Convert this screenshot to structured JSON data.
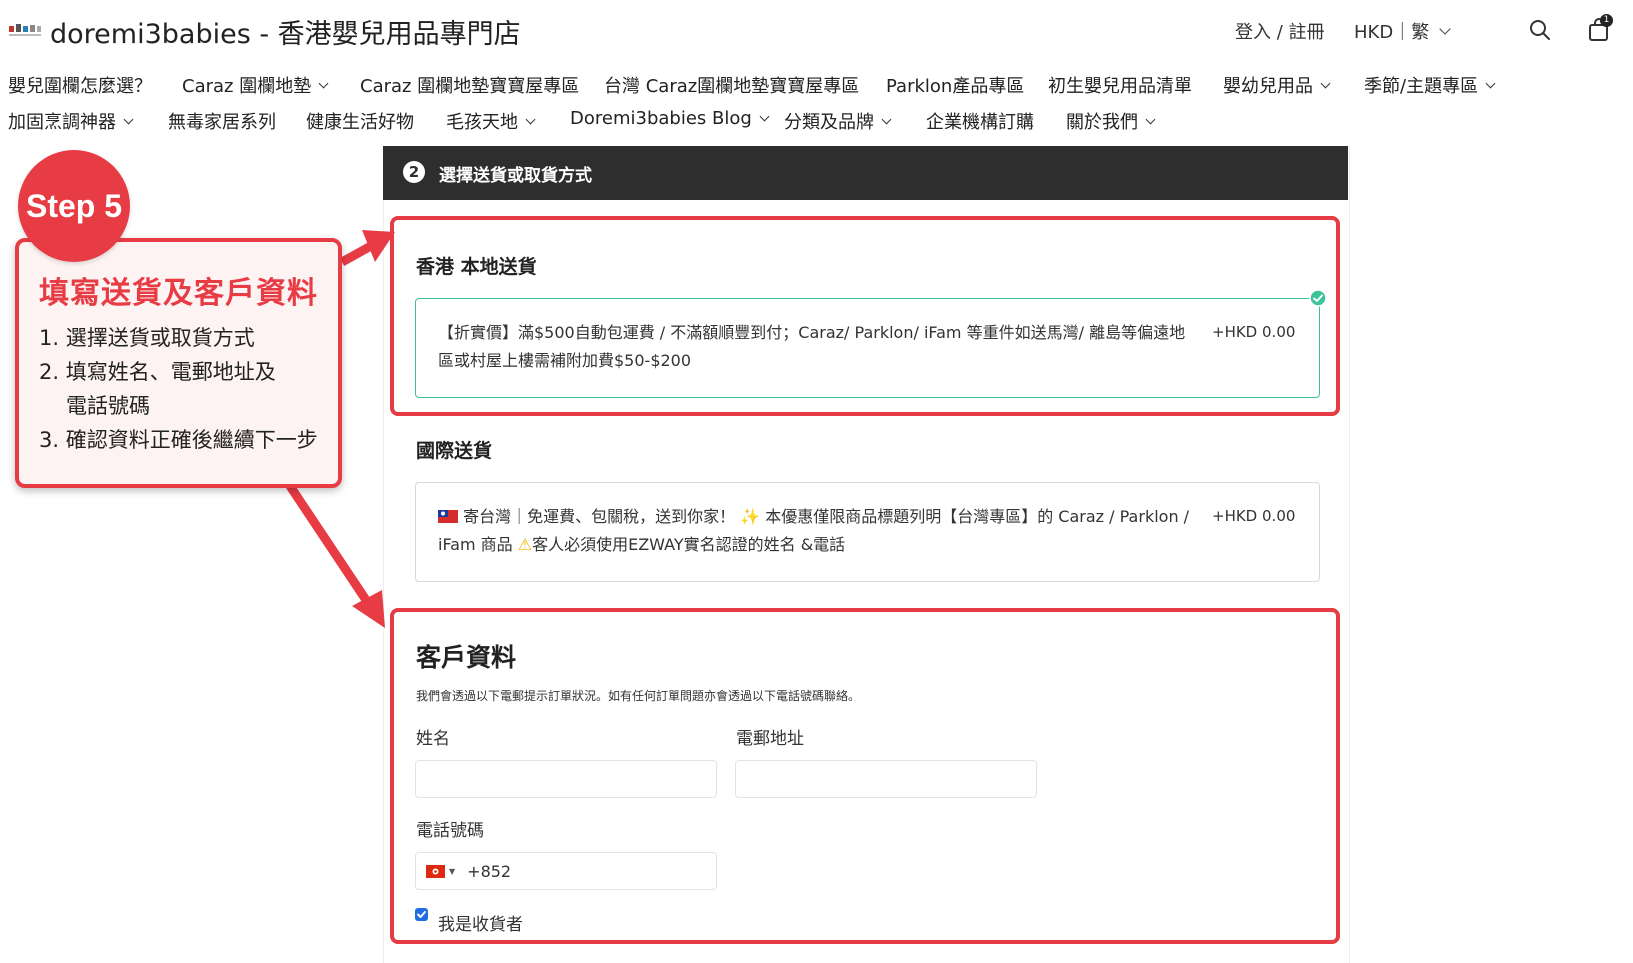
{
  "header": {
    "store_title": "doremi3babies - 香港嬰兒用品專門店",
    "login": "登入 / 註冊",
    "currency_lang": "HKD｜繁",
    "cart_count": "1"
  },
  "nav": {
    "row1": [
      {
        "label": "嬰兒圍欄怎麼選？",
        "dropdown": false
      },
      {
        "label": "Caraz 圍欄地墊",
        "dropdown": true
      },
      {
        "label": "Caraz 圍欄地墊寶寶屋專區",
        "dropdown": false
      },
      {
        "label": "台灣 Caraz圍欄地墊寶寶屋專區",
        "dropdown": false
      },
      {
        "label": "Parklon產品專區",
        "dropdown": false
      },
      {
        "label": "初生嬰兒用品清單",
        "dropdown": false
      },
      {
        "label": "嬰幼兒用品",
        "dropdown": true
      },
      {
        "label": "季節/主題專區",
        "dropdown": true
      }
    ],
    "row2": [
      {
        "label": "加固烹調神器",
        "dropdown": true
      },
      {
        "label": "無毒家居系列",
        "dropdown": false
      },
      {
        "label": "健康生活好物",
        "dropdown": false
      },
      {
        "label": "毛孩天地",
        "dropdown": true
      },
      {
        "label": "Doremi3babies Blog",
        "dropdown": true
      },
      {
        "label": "分類及品牌",
        "dropdown": true
      },
      {
        "label": "企業機構訂購",
        "dropdown": false
      },
      {
        "label": "關於我們",
        "dropdown": true
      }
    ]
  },
  "checkout": {
    "step_number": "2",
    "step_title": "選擇送貨或取貨方式",
    "local": {
      "title": "香港 本地送貨",
      "option_text": "【折實價】滿$500自動包運費 / 不滿額順豐到付；Caraz/ Parklon/ iFam 等重件如送馬灣/ 離島等偏遠地區或村屋上樓需補附加費$50-$200",
      "price": "+HKD 0.00"
    },
    "international": {
      "title": "國際送貨",
      "option_text_a": "寄台灣｜免運費、包關稅，送到你家！",
      "option_text_b": "本優惠僅限商品標題列明【台灣專區】的 Caraz / Parklon / iFam 商品",
      "option_text_c": "客人必須使用EZWAY實名認證的姓名 &電話",
      "price": "+HKD 0.00"
    },
    "customer": {
      "title": "客戶資料",
      "note": "我們會透過以下電郵提示訂單狀況。如有任何訂單問題亦會透過以下電話號碼聯絡。",
      "name_label": "姓名",
      "name_value": "",
      "email_label": "電郵地址",
      "email_value": "",
      "phone_label": "電話號碼",
      "phone_prefix": "+852",
      "recipient_checkbox_label": "我是收貨者",
      "recipient_checked": true
    }
  },
  "callout": {
    "badge": "Step 5",
    "title": "填寫送貨及客戶資料",
    "steps": [
      "1. 選擇送貨或取貨方式",
      "2. 填寫姓名、電郵地址及",
      "電話號碼",
      "3. 確認資料正確後繼續下一步"
    ]
  },
  "colors": {
    "accent_red": "#e83c45",
    "selected_green": "#3cc39a",
    "step_bar": "#2e2e2e"
  }
}
